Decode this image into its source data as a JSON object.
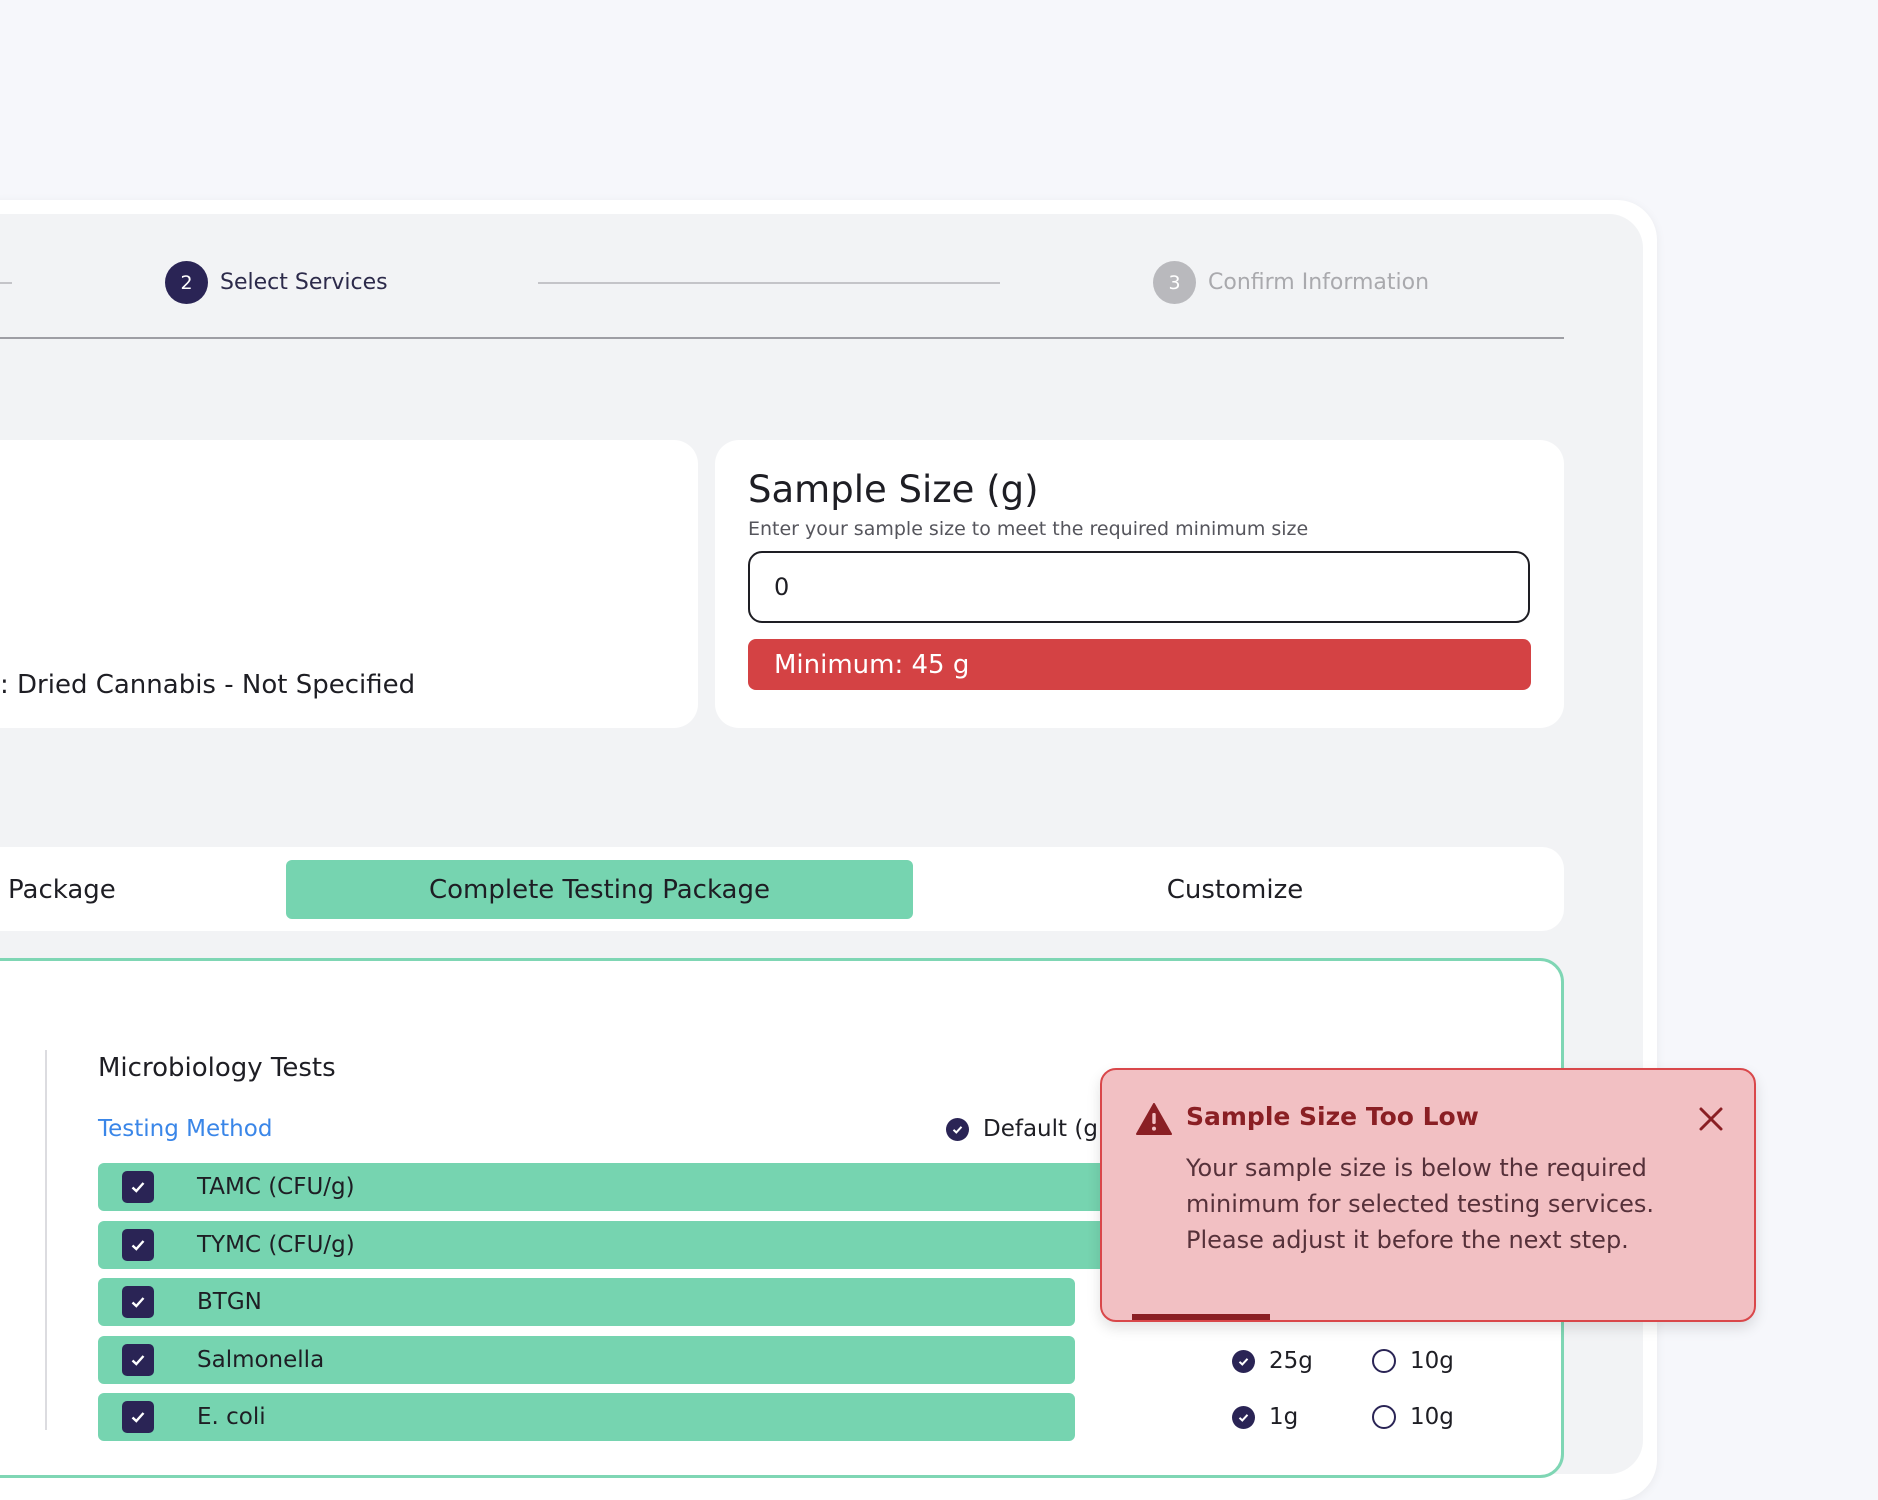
{
  "stepper": {
    "step2": {
      "number": "2",
      "label": "Select Services"
    },
    "step3": {
      "number": "3",
      "label": "Confirm Information"
    }
  },
  "material": {
    "text": ": Dried Cannabis - Not Specified"
  },
  "sample_size": {
    "title": "Sample Size (g)",
    "subtitle": "Enter your sample size to meet the required minimum size",
    "value": "0",
    "minimum_label": "Minimum: 45 g"
  },
  "packages": {
    "tabs": [
      {
        "label": "Package"
      },
      {
        "label": "Complete Testing Package",
        "selected": true
      },
      {
        "label": "Customize"
      }
    ]
  },
  "tests": {
    "section_title": "Microbiology Tests",
    "testing_method_link": "Testing Method",
    "default_option": "Default (g",
    "rows": [
      {
        "label": "TAMC (CFU/g)",
        "checked": true
      },
      {
        "label": "TYMC (CFU/g)",
        "checked": true
      },
      {
        "label": "BTGN",
        "checked": true
      },
      {
        "label": "Salmonella",
        "checked": true,
        "options": [
          "25g",
          "10g"
        ],
        "selected_option": "25g"
      },
      {
        "label": "E. coli",
        "checked": true,
        "options": [
          "1g",
          "10g"
        ],
        "selected_option": "1g"
      }
    ]
  },
  "toast": {
    "title": "Sample Size Too Low",
    "message": "Your sample size is below the required minimum for selected testing services. Please adjust it before the next step.",
    "icon": "warning-icon",
    "progress_remaining": 0.2
  },
  "colors": {
    "primary": "#2a2455",
    "accent_green": "#76d4b0",
    "error_red": "#d44244",
    "toast_bg": "#f2c0c3",
    "link_blue": "#3a86e8"
  }
}
